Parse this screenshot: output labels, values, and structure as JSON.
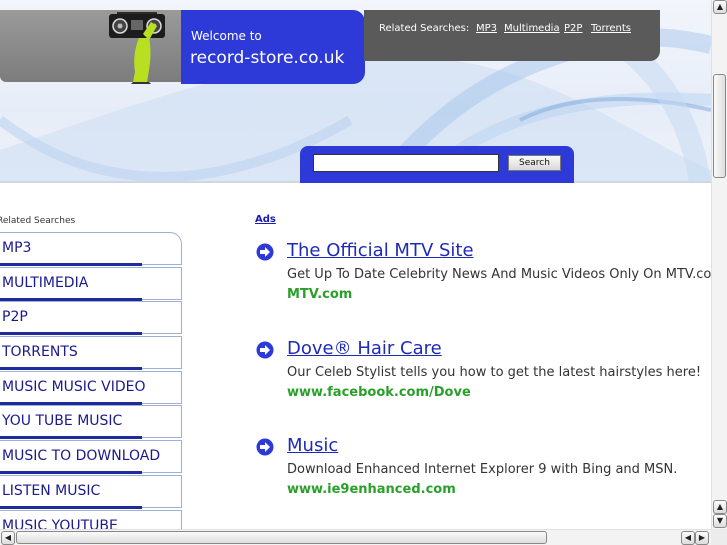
{
  "header": {
    "welcome_small": "Welcome to",
    "site_name": "record-store.co.uk",
    "related_label": "Related Searches:",
    "related_links": [
      "MP3",
      "Multimedia",
      "P2P",
      "Torrents"
    ],
    "search": {
      "value": "",
      "button_label": "Search"
    },
    "colors": {
      "accent_blue": "#2d3ad8",
      "panel_grey": "#5a5a5a"
    }
  },
  "sidebar": {
    "heading": "Related Searches",
    "items": [
      "MP3",
      "MULTIMEDIA",
      "P2P",
      "TORRENTS",
      "MUSIC MUSIC VIDEO",
      "YOU TUBE MUSIC",
      "MUSIC TO DOWNLOAD",
      "LISTEN MUSIC",
      "MUSIC YOUTUBE"
    ]
  },
  "ads": {
    "label": "Ads",
    "items": [
      {
        "title": "The Official MTV Site",
        "description": "Get Up To Date Celebrity News And Music Videos Only On MTV.co.uk",
        "url": "MTV.com"
      },
      {
        "title": "Dove® Hair Care",
        "description": "Our Celeb Stylist tells you how to get the latest hairstyles here!",
        "url": "www.facebook.com/Dove"
      },
      {
        "title": "Music",
        "description": "Download Enhanced Internet Explorer 9 with Bing and MSN.",
        "url": "www.ie9enhanced.com"
      }
    ]
  },
  "scrollbars": {
    "up_icon": "arrow-up-icon",
    "down_icon": "arrow-down-icon",
    "left_icon": "arrow-left-icon",
    "right_icon": "arrow-right-icon"
  }
}
